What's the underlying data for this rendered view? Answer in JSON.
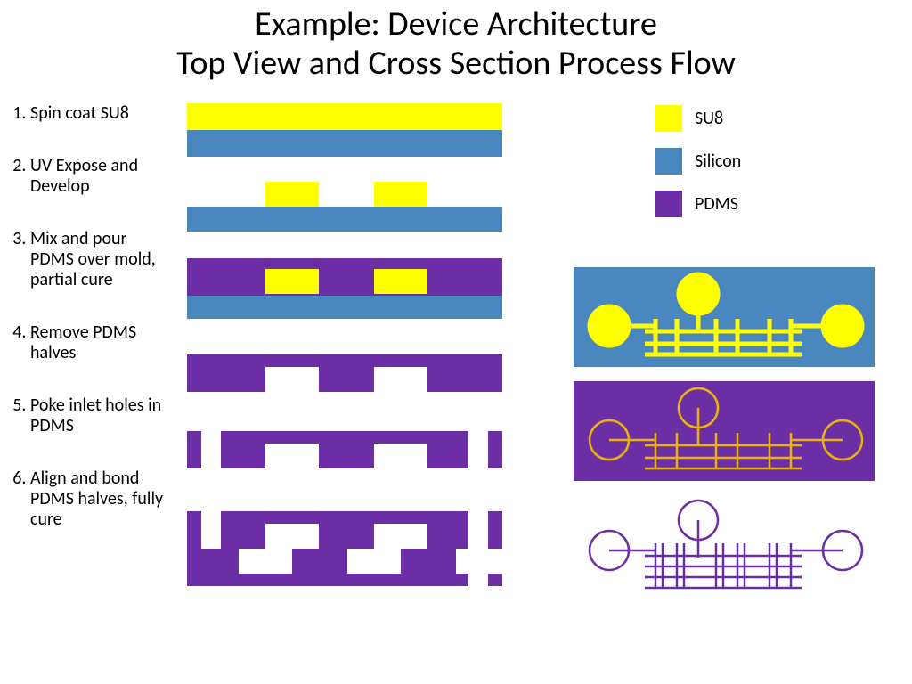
{
  "title_line1": "Example: Device Architecture",
  "title_line2": "Top View and Cross Section Process Flow",
  "steps": {
    "s1": "Spin coat SU8",
    "s2": "UV Expose and Develop",
    "s3": "Mix and pour PDMS over mold, partial cure",
    "s4": "Remove PDMS halves",
    "s5": "Poke inlet holes in PDMS",
    "s6": "Align and bond PDMS halves, fully cure"
  },
  "legend": {
    "su8": "SU8",
    "silicon": "Silicon",
    "pdms": "PDMS"
  },
  "colors": {
    "su8": "#ffff00",
    "silicon": "#4a87bf",
    "pdms": "#6c2ea5",
    "outline": "#eab308"
  }
}
